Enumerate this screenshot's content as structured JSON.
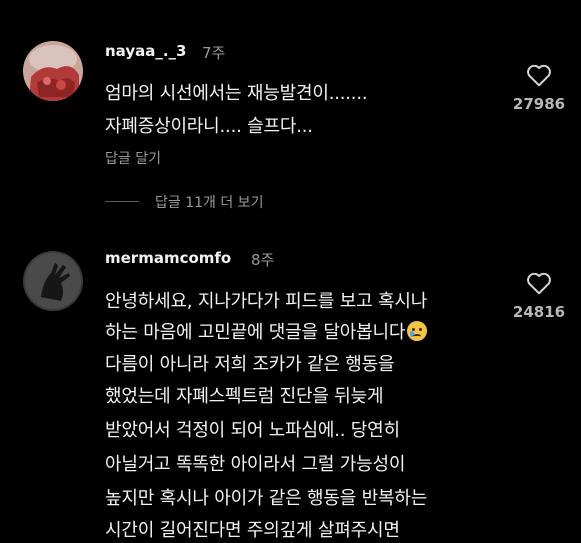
{
  "comments": [
    {
      "username": "nayaa_._3",
      "time": "7주",
      "lines": [
        "엄마의 시선에서는 재능발견이.......",
        "자폐증상이라니.... 슬프다..."
      ],
      "reply_label": "답글 달기",
      "like_count": "27986",
      "avatar_icon": "user-avatar-red-photo"
    },
    {
      "username": "mermamcomfo",
      "time": "8주",
      "lines": [
        "안녕하세요, 지나가다가 피드를 보고 혹시나",
        "하는 마음에 고민끝에 댓글을 달아봅니다",
        "다름이 아니라 저희 조카가 같은 행동을",
        "했었는데 자폐스펙트럼 진단을 뒤늦게",
        "받았어서 걱정이 되어 노파심에.. 당연히",
        "아닐거고 똑똑한 아이라서 그럴 가능성이",
        "높지만 혹시나 아이가 같은 행동을 반복하는",
        "시간이 길어진다면 주의깊게 살펴주시면"
      ],
      "like_count": "24816",
      "avatar_icon": "user-avatar-dark-hand-photo",
      "emoji_icon": "crying-face-emoji"
    }
  ],
  "more_replies_label": "답글 11개 더 보기",
  "icons": {
    "like": "heart-outline-icon"
  },
  "colors": {
    "background": "#000000",
    "text": "#f2f2f2",
    "secondary_text": "#9a9a9a"
  }
}
